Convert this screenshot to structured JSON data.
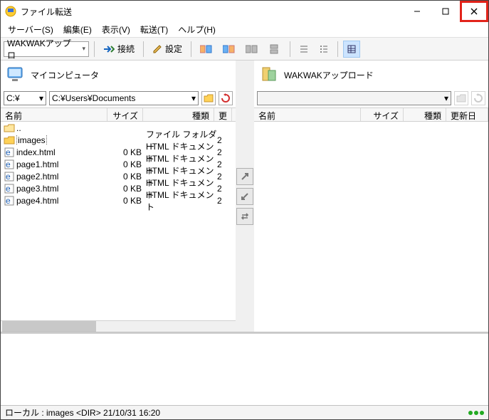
{
  "window": {
    "title": "ファイル転送"
  },
  "menu": {
    "server": "サーバー(S)",
    "edit": "編集(E)",
    "view": "表示(V)",
    "transfer": "転送(T)",
    "help": "ヘルプ(H)"
  },
  "toolbar": {
    "profile": "WAKWAKアップロ",
    "connect": "接続",
    "settings": "設定"
  },
  "local": {
    "title": "マイコンピュータ",
    "drive_label": "C:¥",
    "path": "C:¥Users¥Documents",
    "cols": {
      "name": "名前",
      "size": "サイズ",
      "type": "種類",
      "date": "更"
    },
    "rows": [
      {
        "icon": "up",
        "name": "..",
        "size": "",
        "type": "",
        "date": "",
        "selected": false
      },
      {
        "icon": "folder",
        "name": "images",
        "size": "",
        "type": "ファイル フォルダー",
        "date": "2",
        "selected": true
      },
      {
        "icon": "html",
        "name": "index.html",
        "size": "0 KB",
        "type": "HTML ドキュメント",
        "date": "2",
        "selected": false
      },
      {
        "icon": "html",
        "name": "page1.html",
        "size": "0 KB",
        "type": "HTML ドキュメント",
        "date": "2",
        "selected": false
      },
      {
        "icon": "html",
        "name": "page2.html",
        "size": "0 KB",
        "type": "HTML ドキュメント",
        "date": "2",
        "selected": false
      },
      {
        "icon": "html",
        "name": "page3.html",
        "size": "0 KB",
        "type": "HTML ドキュメント",
        "date": "2",
        "selected": false
      },
      {
        "icon": "html",
        "name": "page4.html",
        "size": "0 KB",
        "type": "HTML ドキュメント",
        "date": "2",
        "selected": false
      }
    ]
  },
  "remote": {
    "title": "WAKWAKアップロード",
    "path": "",
    "cols": {
      "name": "名前",
      "size": "サイズ",
      "type": "種類",
      "date": "更新日時"
    }
  },
  "status": {
    "text": "ローカル : images <DIR> 21/10/31 16:20"
  }
}
